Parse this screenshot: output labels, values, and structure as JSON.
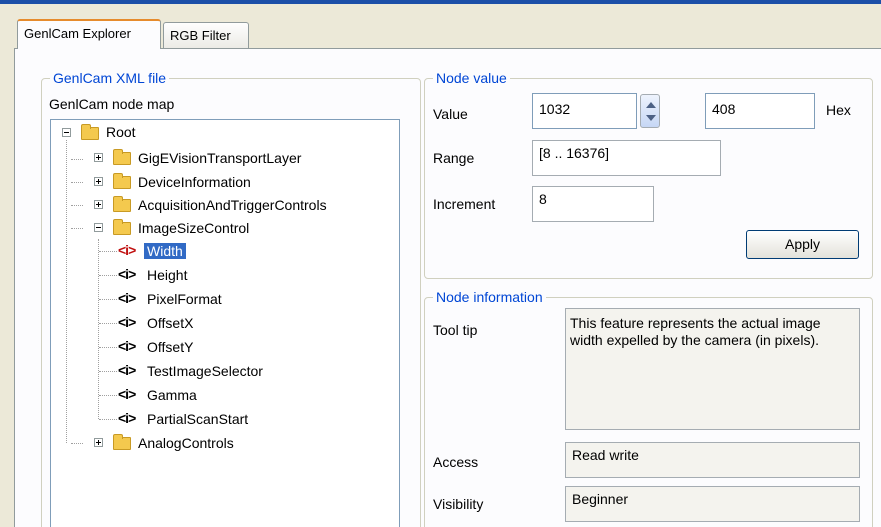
{
  "tabs": [
    {
      "label": "GenlCam Explorer",
      "active": true
    },
    {
      "label": "RGB Filter",
      "active": false
    }
  ],
  "left_group": {
    "legend": "GenlCam XML file",
    "node_map_label": "GenlCam node map"
  },
  "tree": {
    "root": "Root",
    "folders": [
      "GigEVisionTransportLayer",
      "DeviceInformation",
      "AcquisitionAndTriggerControls",
      "ImageSizeControl",
      "AnalogControls"
    ],
    "image_size_children": [
      "Width",
      "Height",
      "PixelFormat",
      "OffsetX",
      "OffsetY",
      "TestImageSelector",
      "Gamma",
      "PartialScanStart"
    ],
    "selected": "Width",
    "icon_text": "<i>"
  },
  "node_value": {
    "legend": "Node value",
    "value_label": "Value",
    "value": "1032",
    "hex_value": "408",
    "hex_label": "Hex",
    "range_label": "Range",
    "range": "[8 .. 16376]",
    "increment_label": "Increment",
    "increment": "8",
    "apply_label": "Apply"
  },
  "node_info": {
    "legend": "Node information",
    "tooltip_label": "Tool tip",
    "tooltip_text": "This feature represents the actual image width expelled by the camera (in pixels).",
    "access_label": "Access",
    "access": "Read write",
    "visibility_label": "Visibility",
    "visibility": "Beginner"
  },
  "icons": {
    "expander_collapsed": "plus-box",
    "expander_expanded": "minus-box",
    "folder": "folder-icon",
    "node": "info-node-icon",
    "spin": "spin-arrows"
  },
  "colors": {
    "accent": "#316ac5",
    "legend_text": "#0046d5",
    "selected_icon": "#c01010",
    "panel_bg": "#ece9d8"
  }
}
